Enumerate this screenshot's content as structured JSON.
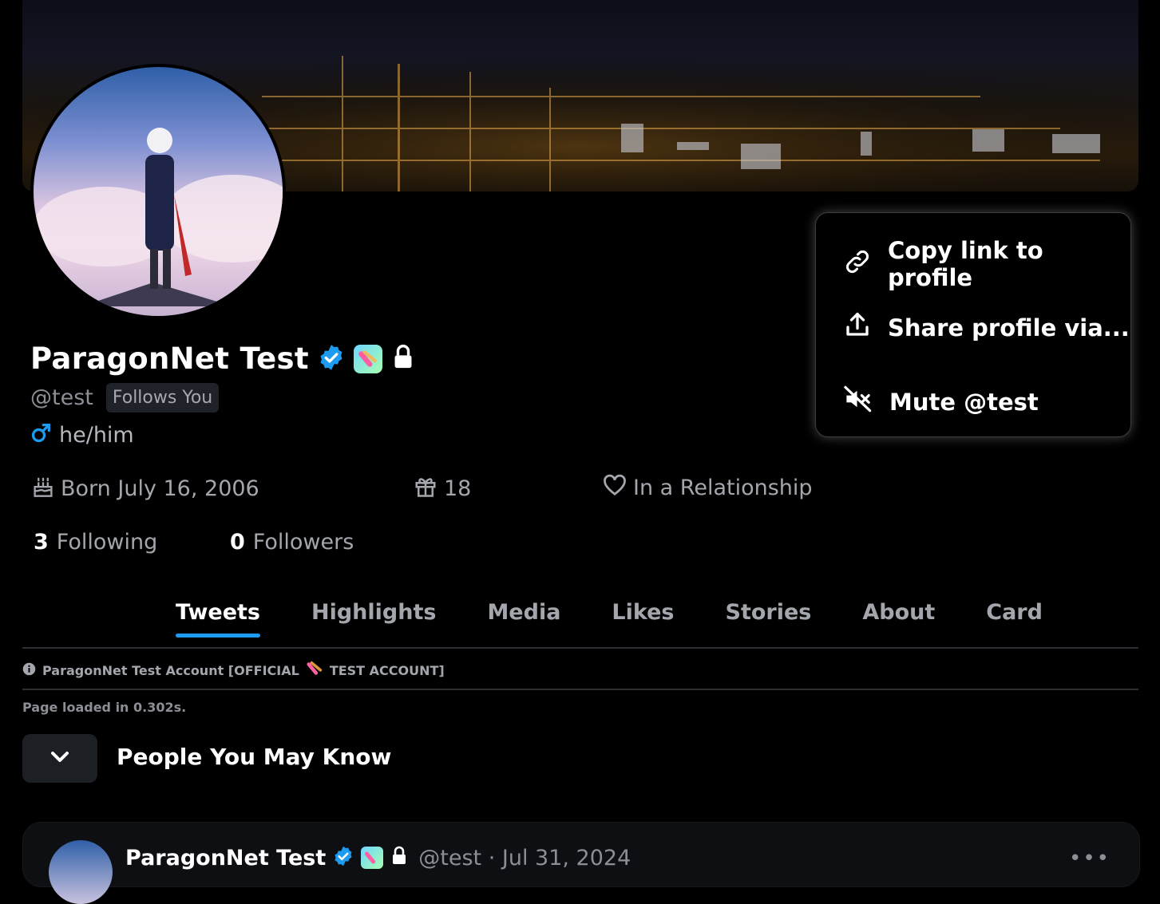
{
  "profile": {
    "name": "ParagonNet Test",
    "handle": "@test",
    "follows_you": "Follows You",
    "pronouns": "he/him",
    "born": "Born July 16, 2006",
    "age": "18",
    "relationship": "In a Relationship",
    "following_count": "3",
    "following_label": "Following",
    "followers_count": "0",
    "followers_label": "Followers"
  },
  "menu": {
    "copy_link": "Copy link to profile",
    "share": "Share profile via...",
    "mute": "Mute @test"
  },
  "tabs": [
    {
      "label": "Tweets",
      "active": true
    },
    {
      "label": "Highlights",
      "active": false
    },
    {
      "label": "Media",
      "active": false
    },
    {
      "label": "Likes",
      "active": false
    },
    {
      "label": "Stories",
      "active": false
    },
    {
      "label": "About",
      "active": false
    },
    {
      "label": "Card",
      "active": false
    }
  ],
  "info": {
    "account_note_prefix": "ParagonNet Test Account [OFFICIAL",
    "account_note_suffix": "TEST ACCOUNT]",
    "page_loaded": "Page loaded in 0.302s."
  },
  "pymk": {
    "label": "People You May Know"
  },
  "tweet": {
    "name": "ParagonNet Test",
    "handle_date": "@test · Jul 31, 2024",
    "more": "•••"
  },
  "colors": {
    "accent": "#1d9bf0",
    "background": "#000000",
    "muted_text": "#a3a7ad"
  },
  "icons": [
    "link-icon",
    "share-icon",
    "mute-icon",
    "verified-icon",
    "lock-icon",
    "male-icon",
    "cake-icon",
    "gift-icon",
    "heart-icon",
    "info-icon",
    "chevron-down-icon",
    "more-icon"
  ]
}
